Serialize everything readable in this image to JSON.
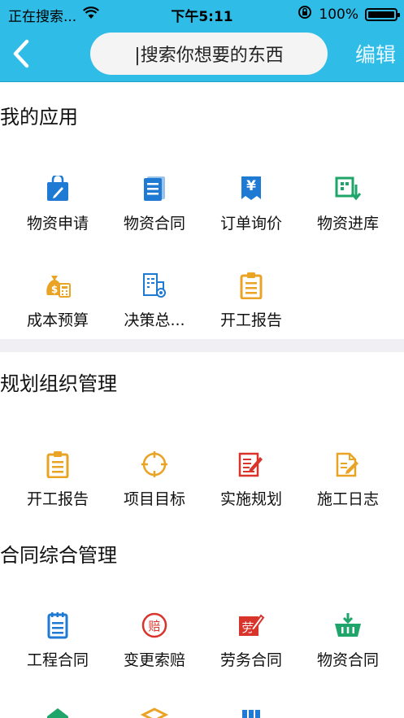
{
  "status_bar": {
    "carrier": "正在搜索...",
    "time": "下午5:11",
    "battery": "100%"
  },
  "header": {
    "search_placeholder": "|搜索你想要的东西",
    "edit_label": "编辑"
  },
  "sections": [
    {
      "title": "我的应用",
      "apps": [
        {
          "label": "物资申请",
          "icon": "bag-edit-icon",
          "color": "#1e7ad3"
        },
        {
          "label": "物资合同",
          "icon": "document-icon",
          "color": "#1e7ad3"
        },
        {
          "label": "订单询价",
          "icon": "yen-document-icon",
          "color": "#1e7ad3"
        },
        {
          "label": "物资进库",
          "icon": "warehouse-in-icon",
          "color": "#1fa56a"
        },
        {
          "label": "成本预算",
          "icon": "money-bag-calculator-icon",
          "color": "#e9a325"
        },
        {
          "label": "决策总...",
          "icon": "report-gear-icon",
          "color": "#1e7ad3"
        },
        {
          "label": "开工报告",
          "icon": "clipboard-icon",
          "color": "#e9a325"
        }
      ]
    },
    {
      "title": "规划组织管理",
      "apps": [
        {
          "label": "开工报告",
          "icon": "clipboard-icon",
          "color": "#e9a325"
        },
        {
          "label": "项目目标",
          "icon": "target-icon",
          "color": "#e9a325"
        },
        {
          "label": "实施规划",
          "icon": "plan-edit-icon",
          "color": "#d9342b"
        },
        {
          "label": "施工日志",
          "icon": "log-edit-icon",
          "color": "#e9a325"
        }
      ]
    },
    {
      "title": "合同综合管理",
      "apps": [
        {
          "label": "工程合同",
          "icon": "notepad-icon",
          "color": "#1e7ad3"
        },
        {
          "label": "变更索赔",
          "icon": "claim-seal-icon",
          "color": "#d9342b"
        },
        {
          "label": "劳务合同",
          "icon": "labor-contract-icon",
          "color": "#d9342b"
        },
        {
          "label": "物资合同",
          "icon": "basket-in-icon",
          "color": "#1fa56a"
        }
      ]
    }
  ],
  "seal_text": "赔",
  "labor_text": "劳",
  "yen_text": "¥"
}
